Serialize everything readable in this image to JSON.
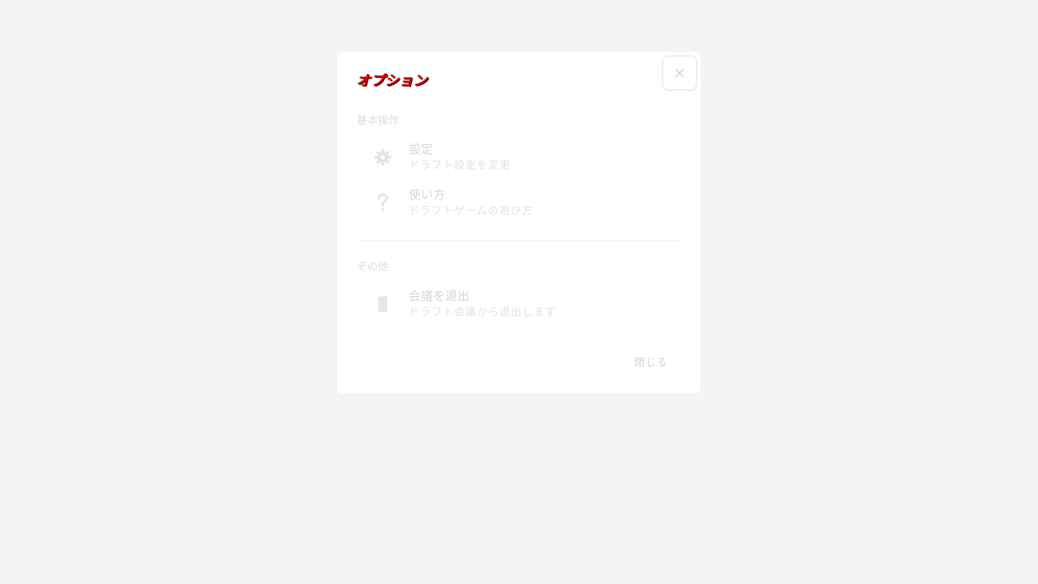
{
  "modal": {
    "title": "オプション",
    "close_icon": "close-icon",
    "footer_close_label": "閉じる"
  },
  "sections": [
    {
      "label": "基本操作",
      "items": [
        {
          "icon": "gear-icon",
          "label": "設定",
          "description": "ドラフト設定を変更"
        },
        {
          "icon": "question-icon",
          "label": "使い方",
          "description": "ドラフトゲームの遊び方"
        }
      ]
    },
    {
      "label": "その他",
      "items": [
        {
          "icon": "door-icon",
          "label": "会議を退出",
          "description": "ドラフト会議から退出します"
        }
      ]
    }
  ],
  "colors": {
    "background": "#f4f4f4",
    "modal_bg": "#ffffff",
    "title_red": "#e10000",
    "muted_text": "#d6d6d6"
  }
}
